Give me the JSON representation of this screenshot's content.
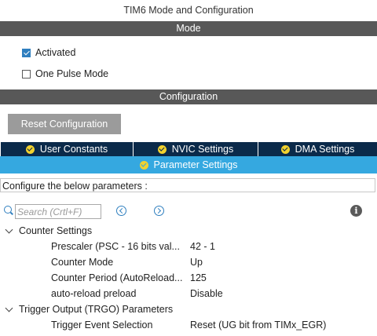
{
  "window": {
    "title": "TIM6 Mode and Configuration"
  },
  "mode_section": {
    "header": "Mode",
    "activated": {
      "label": "Activated",
      "checked": true
    },
    "one_pulse": {
      "label": "One Pulse Mode",
      "checked": false
    }
  },
  "config_section": {
    "header": "Configuration",
    "reset_label": "Reset Configuration",
    "tabs": [
      {
        "label": "User Constants"
      },
      {
        "label": "NVIC Settings"
      },
      {
        "label": "DMA Settings"
      },
      {
        "label": "Parameter Settings",
        "active": true
      }
    ],
    "instructions": "Configure the below parameters :"
  },
  "search": {
    "placeholder": "Search (Crtl+F)"
  },
  "groups": [
    {
      "name": "Counter Settings",
      "params": [
        {
          "name": "Prescaler (PSC - 16 bits val...",
          "value": "42 - 1"
        },
        {
          "name": "Counter Mode",
          "value": "Up"
        },
        {
          "name": "Counter Period (AutoReload...",
          "value": "125"
        },
        {
          "name": "auto-reload preload",
          "value": "Disable"
        }
      ]
    },
    {
      "name": "Trigger Output (TRGO) Parameters",
      "params": [
        {
          "name": "Trigger Event Selection",
          "value": "Reset (UG bit from TIMx_EGR)"
        }
      ]
    }
  ],
  "colors": {
    "section_bar": "#585858",
    "tab_dark": "#0b2a4a",
    "tab_active": "#35a8e0",
    "accent": "#2f7fbf",
    "tab_check": "#f2d22e",
    "reset_button": "#9b9b9b"
  },
  "icons": {
    "tab_status": "check-circle-icon",
    "search": "search-icon",
    "prev": "chevron-left-circle-icon",
    "next": "chevron-right-circle-icon",
    "info": "info-icon",
    "group_toggle": "chevron-down-icon"
  }
}
